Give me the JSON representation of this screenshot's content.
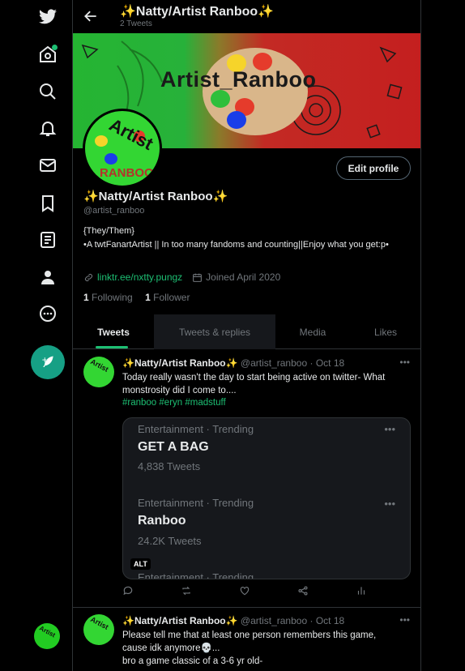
{
  "header": {
    "title": "✨Natty/Artist Ranboo✨",
    "tweet_count": "2 Tweets"
  },
  "banner": {
    "text": "Artist_Ranboo"
  },
  "avatar": {
    "line1": "Artist",
    "line2": "RANBOO"
  },
  "profile": {
    "edit_label": "Edit profile",
    "name": "✨Natty/Artist Ranboo✨",
    "handle": "@artist_ranboo",
    "bio_line1": "{They/Them}",
    "bio_line2": "•A twtFanartArtist || In too many fandoms and counting||Enjoy what you get:p•",
    "link": "linktr.ee/nxtty.pungz",
    "joined": "Joined April 2020",
    "following_count": "1",
    "following_label": "Following",
    "follower_count": "1",
    "follower_label": "Follower"
  },
  "tabs": [
    {
      "label": "Tweets"
    },
    {
      "label": "Tweets & replies"
    },
    {
      "label": "Media"
    },
    {
      "label": "Likes"
    }
  ],
  "tweets": [
    {
      "name": "✨Natty/Artist Ranboo✨",
      "handle": "@artist_ranboo",
      "sep": "·",
      "date": "Oct 18",
      "text": "Today really wasn't the day to start being active on twitter- What monstrosity did I come to....",
      "hashtags": "#ranboo #eryn #madstuff",
      "avatar_text": "Artist"
    },
    {
      "name": "✨Natty/Artist Ranboo✨",
      "handle": "@artist_ranboo",
      "sep": "·",
      "date": "Oct 18",
      "text": "Please tell me that at least one person remembers this game, cause idk anymore💀...",
      "text2": "bro a game classic of a 3-6 yr old-",
      "avatar_text": "Artist"
    }
  ],
  "media": {
    "alt": "ALT",
    "trends": [
      {
        "category": "Entertainment · Trending",
        "name": "GET A BAG",
        "count": "4,838 Tweets"
      },
      {
        "category": "Entertainment · Trending",
        "name": "Ranboo",
        "count": "24.2K Tweets"
      },
      {
        "category": "Entertainment · Trending"
      }
    ]
  },
  "icons": {
    "accent": "#1dbf73",
    "compose_bg": "#16a085"
  }
}
